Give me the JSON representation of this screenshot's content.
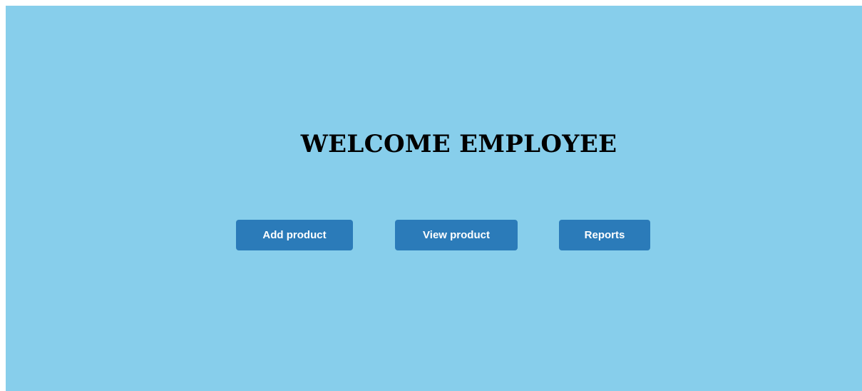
{
  "page": {
    "title": "WELCOME EMPLOYEE",
    "background_color": "#87ceeb",
    "button_color": "#2b7bb9"
  },
  "actions": {
    "add_product_label": "Add product",
    "view_product_label": "View product",
    "reports_label": "Reports"
  }
}
